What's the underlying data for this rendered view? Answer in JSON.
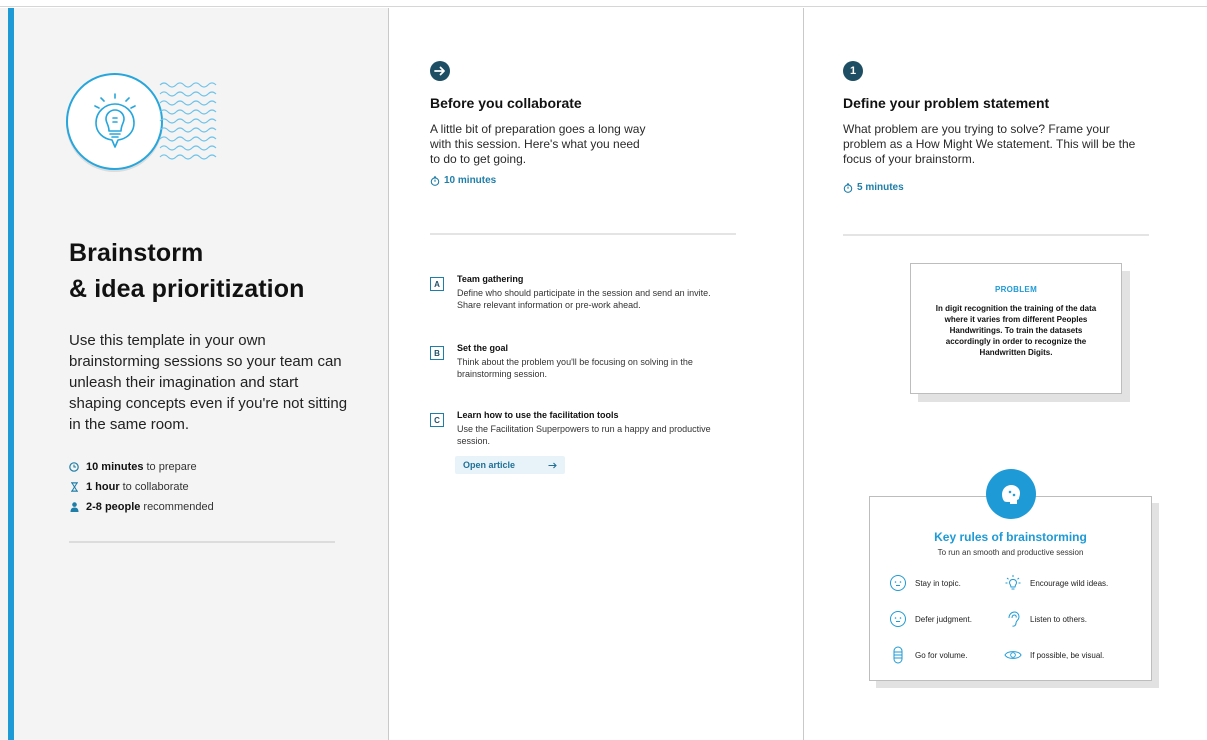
{
  "colors": {
    "accent": "#1e9ad6",
    "dark_badge": "#1d4e63",
    "timer": "#1f7ea8"
  },
  "left": {
    "title_line1": "Brainstorm",
    "title_line2": "& idea prioritization",
    "description": "Use this template in your own brainstorming sessions so your team can unleash their imagination and start shaping concepts even if you're not sitting in the same room.",
    "meta": [
      {
        "icon": "clock-icon",
        "bold": "10 minutes",
        "rest": "to prepare"
      },
      {
        "icon": "hourglass-icon",
        "bold": "1 hour",
        "rest": "to collaborate"
      },
      {
        "icon": "person-icon",
        "bold": "2-8 people",
        "rest": "recommended"
      }
    ]
  },
  "middle": {
    "icon": "arrow-right-icon",
    "title": "Before you collaborate",
    "body_line1": "A little bit of preparation goes a long way",
    "body_line2": "with this session. Here's what you need",
    "body_line3": "to do to get going.",
    "timer": "10 minutes",
    "tasks": [
      {
        "badge": "A",
        "title": "Team gathering",
        "desc": "Define who should participate in the session and send an invite. Share relevant information or pre-work ahead."
      },
      {
        "badge": "B",
        "title": "Set the goal",
        "desc": "Think about the problem you'll be focusing on solving in the brainstorming session."
      },
      {
        "badge": "C",
        "title": "Learn how to use the facilitation tools",
        "desc": "Use the Facilitation Superpowers to run a happy and productive session."
      }
    ],
    "open_article": "Open article"
  },
  "right": {
    "step": "1",
    "title": "Define your problem statement",
    "body_line1": "What problem are you trying to solve? Frame your",
    "body_line2": "problem as a How Might We statement. This will be the",
    "body_line3": "focus of your brainstorm.",
    "timer": "5 minutes",
    "problem": {
      "label": "PROBLEM",
      "text": "In digit recognition the training of the data where it varies from different Peoples Handwritings. To train the datasets accordingly in order to recognize the Handwritten Digits."
    },
    "rules": {
      "title": "Key rules of brainstorming",
      "subtitle": "To run an smooth and productive session",
      "items": [
        {
          "icon": "face-icon",
          "label": "Stay in topic."
        },
        {
          "icon": "lightbulb-icon",
          "label": "Encourage wild ideas."
        },
        {
          "icon": "face-icon",
          "label": "Defer judgment."
        },
        {
          "icon": "ear-icon",
          "label": "Listen to others."
        },
        {
          "icon": "stack-icon",
          "label": "Go for volume."
        },
        {
          "icon": "eye-icon",
          "label": "If possible, be visual."
        }
      ]
    }
  }
}
